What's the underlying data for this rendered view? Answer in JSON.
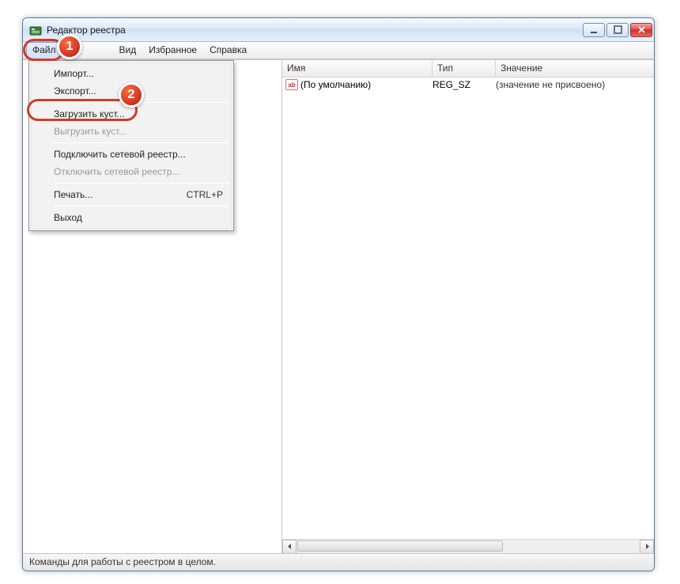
{
  "window": {
    "title": "Редактор реестра"
  },
  "menubar": {
    "file": "Файл",
    "view": "Вид",
    "favorites": "Избранное",
    "help": "Справка"
  },
  "file_menu": {
    "import": "Импорт...",
    "export": "Экспорт...",
    "load_hive": "Загрузить куст...",
    "unload_hive": "Выгрузить куст...",
    "connect_net": "Подключить сетевой реестр...",
    "disconnect_net": "Отключить сетевой реестр...",
    "print": "Печать...",
    "print_shortcut": "CTRL+P",
    "exit": "Выход"
  },
  "columns": {
    "name": "Имя",
    "type": "Тип",
    "value": "Значение"
  },
  "rows": [
    {
      "icon": "ab",
      "name": "(По умолчанию)",
      "type": "REG_SZ",
      "value": "(значение не присвоено)"
    }
  ],
  "status": "Команды для работы с реестром в целом.",
  "badges": {
    "one": "1",
    "two": "2"
  }
}
